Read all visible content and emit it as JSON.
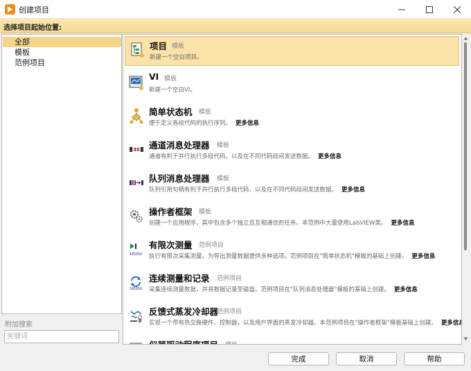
{
  "window": {
    "title": "创建项目",
    "controls": [
      "minimize-icon",
      "maximize-icon",
      "close-icon"
    ]
  },
  "header": {
    "label": "选择项目起始位置:"
  },
  "tree": {
    "items": [
      {
        "label": "全部",
        "selected": true
      },
      {
        "label": "模板",
        "selected": false
      },
      {
        "label": "范例项目",
        "selected": false
      }
    ]
  },
  "search": {
    "label": "附加搜索",
    "placeholder": "关键词"
  },
  "projects": [
    {
      "name": "项目",
      "type": "模板",
      "desc": "新建一个空白项目。",
      "more": "",
      "icon": "project-icon",
      "selected": true
    },
    {
      "name": "VI",
      "type": "模板",
      "desc": "新建一个空白VI。",
      "more": "",
      "icon": "vi-icon",
      "selected": false
    },
    {
      "name": "简单状态机",
      "type": "模板",
      "desc": "便于定义各段代码的执行序列。",
      "more": "更多信息",
      "icon": "state-machine-icon",
      "selected": false
    },
    {
      "name": "通道消息处理器",
      "type": "模板",
      "desc": "通道有利于并行执行多段代码，以及在不同代码段间发送数据。",
      "more": "更多信息",
      "icon": "channel-handler-icon",
      "selected": false
    },
    {
      "name": "队列消息处理器",
      "type": "模板",
      "desc": "队列引用句柄有利于并行执行多段代码，以及在不同代码段间发送数据。",
      "more": "更多信息",
      "icon": "queue-handler-icon",
      "selected": false
    },
    {
      "name": "操作者框架",
      "type": "模板",
      "desc": "创建一个应用程序，其中包含多个独立且互相通信的任务。本范例中大量使用LabVIEW类。",
      "more": "更多信息",
      "icon": "actor-framework-icon",
      "selected": false
    },
    {
      "name": "有限次测量",
      "type": "范例项目",
      "desc": "执行有限次采集测量，为导出测量数据提供多种选项。范例项目在\"简单状态机\"模板的基础上创建。",
      "more": "更多信息",
      "icon": "finite-measurement-icon",
      "selected": false
    },
    {
      "name": "连续测量和记录",
      "type": "范例项目",
      "desc": "采集连续测量数据，并将数据记录至磁盘。范例项目在\"队列消息处理器\"模板的基础上创建。",
      "more": "更多信息",
      "icon": "continuous-logging-icon",
      "selected": false
    },
    {
      "name": "反馈式蒸发冷却器",
      "type": "范例项目",
      "desc": "实现一个带有热交换硬件、控制器，以及用户界面的蒸发冷却器。本范例项目在\"操作者框架\"模板基础上创建。",
      "more": "更多信息",
      "icon": "cooler-icon",
      "selected": false
    },
    {
      "name": "仪器驱动程序项目",
      "type": "模板",
      "desc": "",
      "more": "",
      "icon": "instrument-driver-icon",
      "selected": false
    }
  ],
  "buttons": {
    "finish": "完成",
    "cancel": "取消",
    "help": "帮助"
  },
  "colors": {
    "accent": "#f08a1c",
    "selection": "#f6d58a",
    "header_band": "#f6d991"
  }
}
